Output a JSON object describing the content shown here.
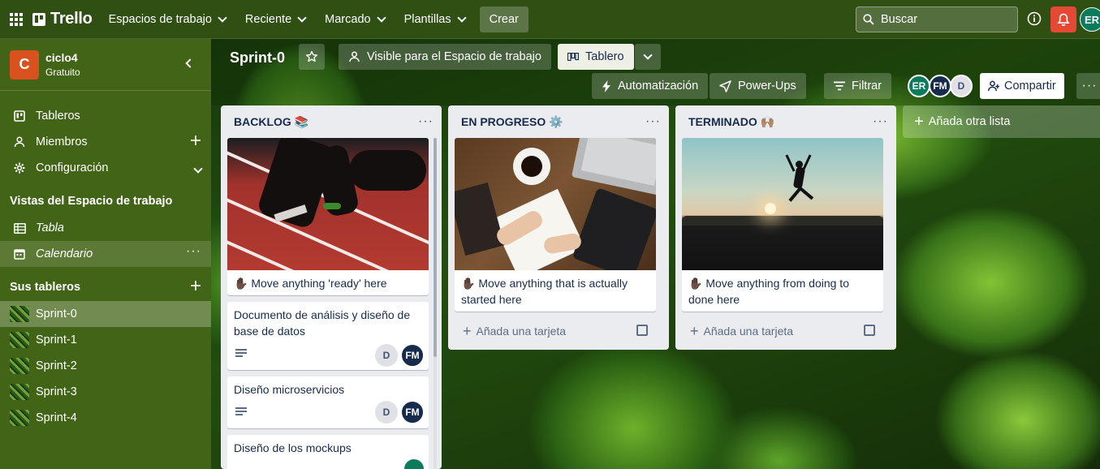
{
  "topbar": {
    "brand": "Trello",
    "menus": [
      "Espacios de trabajo",
      "Reciente",
      "Marcado",
      "Plantillas"
    ],
    "create_label": "Crear",
    "search_placeholder": "Buscar",
    "user_initials": "ER"
  },
  "sidebar": {
    "workspace_initial": "C",
    "workspace_name": "ciclo4",
    "workspace_plan": "Gratuito",
    "items": [
      {
        "label": "Tableros",
        "icon": "board-icon"
      },
      {
        "label": "Miembros",
        "icon": "person-icon"
      },
      {
        "label": "Configuración",
        "icon": "gear-icon"
      }
    ],
    "views_heading": "Vistas del Espacio de trabajo",
    "views": [
      {
        "label": "Tabla",
        "icon": "table-icon"
      },
      {
        "label": "Calendario",
        "icon": "calendar-icon"
      }
    ],
    "boards_heading": "Sus tableros",
    "boards": [
      "Sprint-0",
      "Sprint-1",
      "Sprint-2",
      "Sprint-3",
      "Sprint-4"
    ]
  },
  "board": {
    "title": "Sprint-0",
    "visibility_label": "Visible para el Espacio de trabajo",
    "view_label": "Tablero",
    "automation_label": "Automatización",
    "powerups_label": "Power-Ups",
    "filter_label": "Filtrar",
    "members": [
      "ER",
      "FM",
      "D"
    ],
    "share_label": "Compartir",
    "add_list_label": "Añada otra lista"
  },
  "lists": [
    {
      "title": "BACKLOG 📚",
      "cards": [
        {
          "title": "✋🏿 Move anything 'ready' here"
        },
        {
          "title": "Documento de análisis y diseño de base de datos",
          "members": [
            "D",
            "FM"
          ]
        },
        {
          "title": "Diseño microservicios",
          "members": [
            "D",
            "FM"
          ]
        },
        {
          "title": "Diseño de los mockups"
        }
      ]
    },
    {
      "title": "EN PROGRESO ⚙️",
      "cards": [
        {
          "title": "✋🏿 Move anything that is actually started here"
        }
      ],
      "add_card_label": "Añada una tarjeta"
    },
    {
      "title": "TERMINADO 🙌🏽",
      "cards": [
        {
          "title": "✋🏿 Move anything from doing to done here"
        }
      ],
      "add_card_label": "Añada una tarjeta"
    }
  ],
  "colors": {
    "topbar": "#2f4f13",
    "sidebar": "#426416",
    "list": "#ebecf0",
    "notification": "#e34935",
    "workspace_logo": "#d9521d"
  }
}
